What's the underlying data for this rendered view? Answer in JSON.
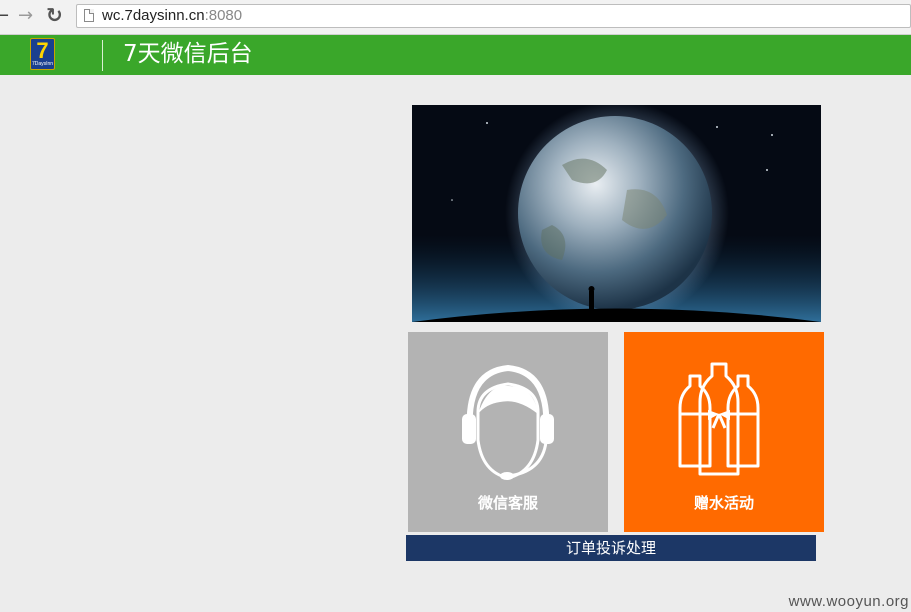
{
  "browser": {
    "url_host": "wc.7daysinn.cn",
    "url_port": ":8080",
    "back_glyph": "←",
    "forward_glyph": "→",
    "reload_glyph": "↻"
  },
  "header": {
    "logo_number": "7",
    "logo_text": "7DaysInn",
    "title": "7天微信后台"
  },
  "tiles": {
    "service": {
      "label": "微信客服",
      "icon": "headset-person-icon",
      "color": "#b3b3b3"
    },
    "gift": {
      "label": "赠水活动",
      "icon": "water-bottles-icon",
      "color": "#ff6a00"
    }
  },
  "complaint": {
    "label": "订单投诉处理",
    "color": "#1c3766"
  },
  "watermark": "www.wooyun.org",
  "colors": {
    "header": "#3aa72a",
    "background": "#ececec"
  }
}
